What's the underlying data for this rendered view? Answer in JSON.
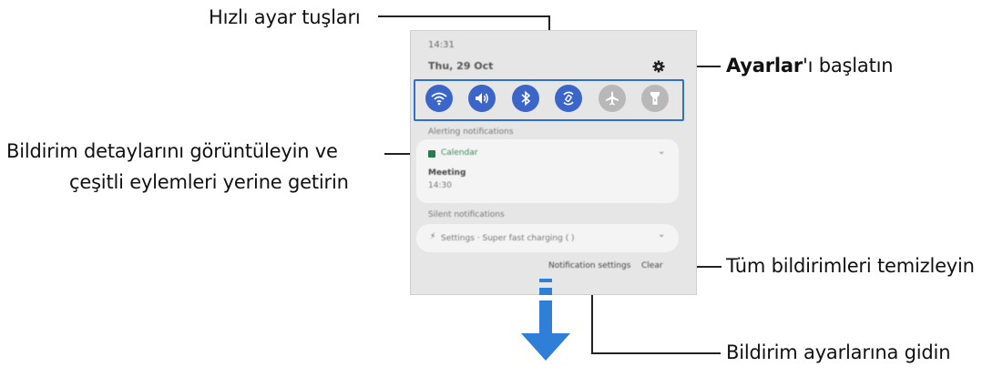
{
  "callouts": {
    "quick_settings": "Hızlı ayar tuşları",
    "settings_bold": "Ayarlar",
    "settings_rest": "'ı başlatın",
    "notif_details_line1": "Bildirim detaylarını görüntüleyin ve",
    "notif_details_line2": "çeşitli eylemleri yerine getirin",
    "clear_all": "Tüm bildirimleri temizleyin",
    "notif_settings": "Bildirim ayarlarına gidin"
  },
  "phone": {
    "time": "14:31",
    "date": "Thu, 29 Oct",
    "alerting_header": "Alerting notifications",
    "calendar_app": "Calendar",
    "meeting_title": "Meeting",
    "meeting_time": "14:30",
    "silent_header": "Silent notifications",
    "silent_item": "Settings · Super fast charging (              )",
    "notification_settings": "Notification settings",
    "clear": "Clear"
  },
  "quick_buttons": [
    {
      "icon": "wifi-icon",
      "state": "on"
    },
    {
      "icon": "sound-icon",
      "state": "on"
    },
    {
      "icon": "bluetooth-icon",
      "state": "on"
    },
    {
      "icon": "auto-rotate-icon",
      "state": "on"
    },
    {
      "icon": "airplane-icon",
      "state": "off"
    },
    {
      "icon": "flashlight-icon",
      "state": "off"
    }
  ],
  "colors": {
    "accent": "#3c65c9",
    "highlight_border": "#2f6fcf",
    "arrow": "#2f7fd8"
  }
}
